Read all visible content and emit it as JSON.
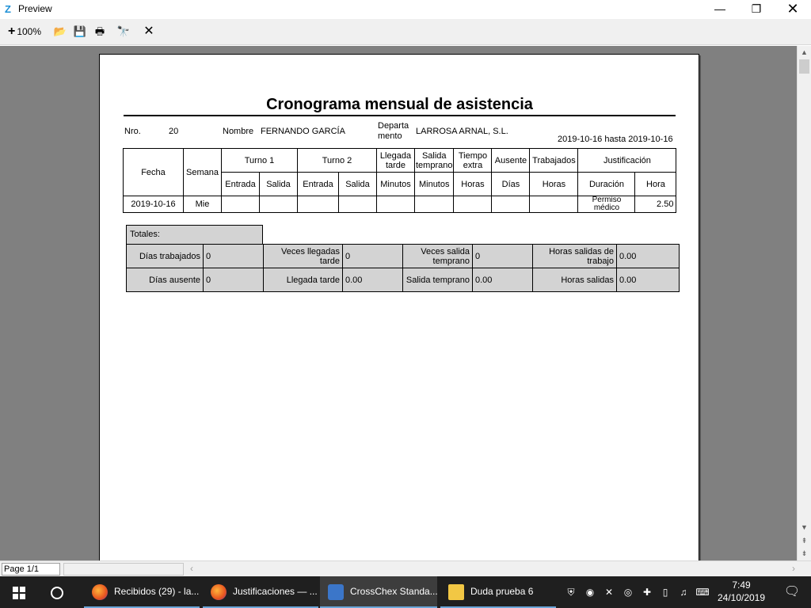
{
  "window": {
    "title": "Preview",
    "min_glyph": "—",
    "max_glyph": "❐",
    "close_glyph": "✕",
    "app_glyph": "Z"
  },
  "toolbar": {
    "zoom_label": "100%",
    "zoom_glyph": "+",
    "open_glyph": "📂",
    "save_glyph": "💾",
    "print_glyph": "🖶",
    "find_glyph": "🔭",
    "close_glyph": "✕"
  },
  "report": {
    "title": "Cronograma mensual de asistencia",
    "nro_label": "Nro.",
    "nro_value": "20",
    "nombre_label": "Nombre",
    "nombre_value": "FERNANDO GARCÍA",
    "depto_label_1": "Departa",
    "depto_label_2": "mento",
    "depto_value": "LARROSA ARNAL, S.L.",
    "range": "2019-10-16 hasta 2019-10-16",
    "headers": {
      "fecha": "Fecha",
      "semana": "Semana",
      "turno1": "Turno 1",
      "turno2": "Turno 2",
      "llegada_tarde": "Llegada tarde",
      "salida_temprano": "Salida temprano",
      "tiempo_extra": "Tiempo extra",
      "ausente": "Ausente",
      "trabajados": "Trabajados",
      "justificacion": "Justificación",
      "entrada": "Entrada",
      "salida": "Salida",
      "minutos": "Minutos",
      "horas": "Horas",
      "dias": "Días",
      "duracion": "Duración",
      "hora": "Hora"
    },
    "rows": [
      {
        "fecha": "2019-10-16",
        "semana": "Mie",
        "t1_entrada": "",
        "t1_salida": "",
        "t2_entrada": "",
        "t2_salida": "",
        "llegada": "",
        "salida": "",
        "extra": "",
        "ausente": "",
        "trabajados": "",
        "duracion": "Permiso médico",
        "hora": "2.50"
      }
    ],
    "totals": {
      "label": "Totales:",
      "dias_trabajados_label": "Días trabajados",
      "dias_trabajados": "0",
      "veces_llegadas_tarde_label": "Veces llegadas tarde",
      "veces_llegadas_tarde": "0",
      "veces_salida_temprano_label": "Veces salida temprano",
      "veces_salida_temprano": "0",
      "horas_salidas_trabajo_label": "Horas salidas de trabajo",
      "horas_salidas_trabajo": "0.00",
      "dias_ausente_label": "Días ausente",
      "dias_ausente": "0",
      "llegada_tarde_label": "Llegada tarde",
      "llegada_tarde": "0.00",
      "salida_temprano_label": "Salida temprano",
      "salida_temprano": "0.00",
      "horas_salidas_label": "Horas salidas",
      "horas_salidas": "0.00"
    }
  },
  "statusbar": {
    "page": "Page 1/1"
  },
  "taskbar": {
    "apps": [
      {
        "label": "Recibidos (29) - la..."
      },
      {
        "label": "Justificaciones — ..."
      },
      {
        "label": "CrossChex Standa..."
      },
      {
        "label": "Duda prueba 6"
      }
    ],
    "time": "7:49",
    "date": "24/10/2019"
  }
}
